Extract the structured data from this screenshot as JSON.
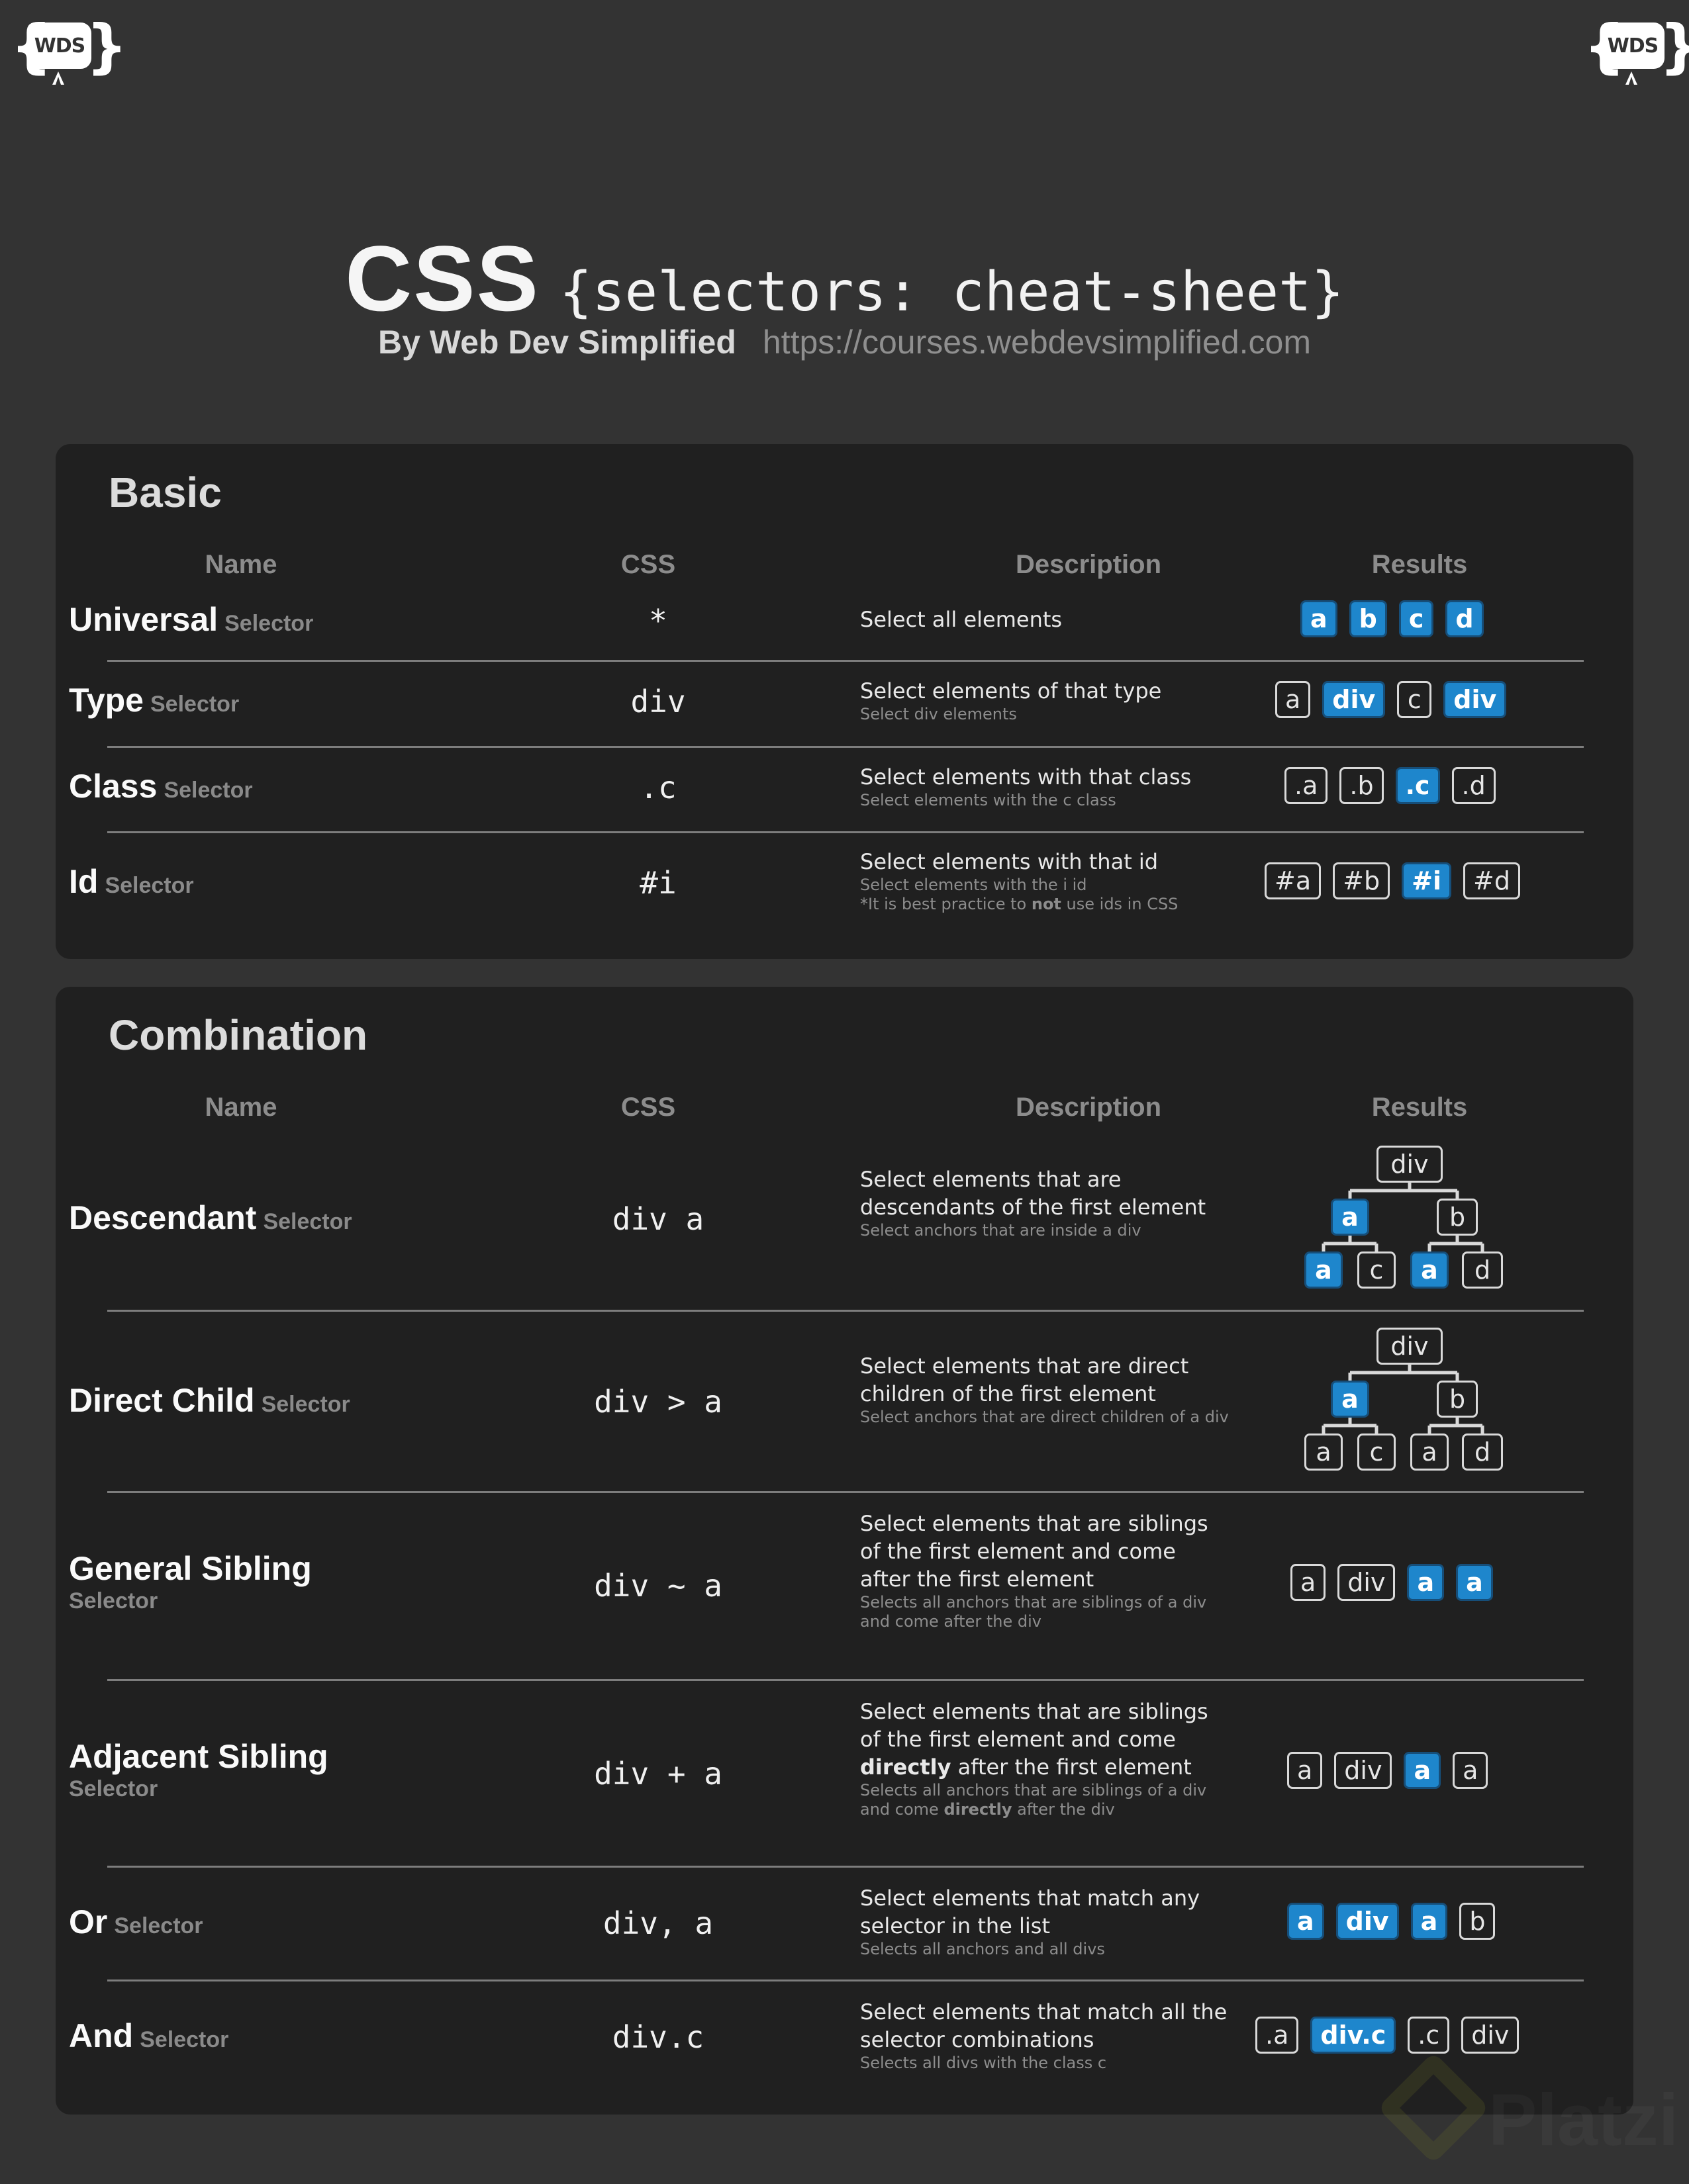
{
  "logo": {
    "text": "WDS",
    "left_brace": "{",
    "right_brace": "}"
  },
  "header": {
    "title_main": "CSS",
    "title_code": "{selectors: cheat-sheet}",
    "byline": "By Web Dev Simplified",
    "url": "https://courses.webdevsimplified.com"
  },
  "columns": {
    "name": "Name",
    "css": "CSS",
    "description": "Description",
    "results": "Results"
  },
  "colors": {
    "highlight": "#1e86cc",
    "card_bg": "#202020",
    "page_bg": "#333333"
  },
  "basic": {
    "title": "Basic",
    "rows": [
      {
        "name": "Universal",
        "suffix": "Selector",
        "css": "*",
        "desc": "Select all elements",
        "sub": "",
        "note": "",
        "results": [
          {
            "label": "a",
            "on": true
          },
          {
            "label": "b",
            "on": true
          },
          {
            "label": "c",
            "on": true
          },
          {
            "label": "d",
            "on": true
          }
        ]
      },
      {
        "name": "Type",
        "suffix": "Selector",
        "css": "div",
        "desc": "Select elements of that type",
        "sub": "Select div elements",
        "note": "",
        "results": [
          {
            "label": "a",
            "on": false
          },
          {
            "label": "div",
            "on": true
          },
          {
            "label": "c",
            "on": false
          },
          {
            "label": "div",
            "on": true
          }
        ]
      },
      {
        "name": "Class",
        "suffix": "Selector",
        "css": ".c",
        "desc": "Select elements with that class",
        "sub": "Select elements with the c class",
        "note": "",
        "results": [
          {
            "label": ".a",
            "on": false
          },
          {
            "label": ".b",
            "on": false
          },
          {
            "label": ".c",
            "on": true
          },
          {
            "label": ".d",
            "on": false
          }
        ]
      },
      {
        "name": "Id",
        "suffix": "Selector",
        "css": "#i",
        "desc": "Select elements with that id",
        "sub": "Select elements with the i id",
        "note_pre": "*It is best practice to ",
        "note_bold": "not",
        "note_post": " use ids in CSS",
        "results": [
          {
            "label": "#a",
            "on": false
          },
          {
            "label": "#b",
            "on": false
          },
          {
            "label": "#i",
            "on": true
          },
          {
            "label": "#d",
            "on": false
          }
        ]
      }
    ]
  },
  "combination": {
    "title": "Combination",
    "rows": [
      {
        "name": "Descendant",
        "suffix": "Selector",
        "css": "div a",
        "desc": "Select elements that are descendants of the first element",
        "sub": "Select anchors that are inside a div",
        "tree": {
          "root": "div",
          "left": {
            "label": "a",
            "on": true
          },
          "right": {
            "label": "b",
            "on": false
          },
          "leaves": [
            {
              "label": "a",
              "on": true
            },
            {
              "label": "c",
              "on": false
            },
            {
              "label": "a",
              "on": true
            },
            {
              "label": "d",
              "on": false
            }
          ]
        }
      },
      {
        "name": "Direct Child",
        "suffix": "Selector",
        "css": "div > a",
        "desc": "Select elements that are direct children of the first element",
        "sub": "Select anchors that are direct children of a div",
        "tree": {
          "root": "div",
          "left": {
            "label": "a",
            "on": true
          },
          "right": {
            "label": "b",
            "on": false
          },
          "leaves": [
            {
              "label": "a",
              "on": false
            },
            {
              "label": "c",
              "on": false
            },
            {
              "label": "a",
              "on": false
            },
            {
              "label": "d",
              "on": false
            }
          ]
        }
      },
      {
        "name": "General Sibling",
        "suffix": "Selector",
        "css": "div ~ a",
        "desc": "Select elements that are siblings of the first element and come after the first element",
        "sub": "Selects all anchors that are siblings of a div and come after the div",
        "results": [
          {
            "label": "a",
            "on": false
          },
          {
            "label": "div",
            "on": false
          },
          {
            "label": "a",
            "on": true
          },
          {
            "label": "a",
            "on": true
          }
        ]
      },
      {
        "name": "Adjacent Sibling",
        "suffix": "Selector",
        "css": "div + a",
        "desc_pre": "Select elements that are siblings of the first element and come ",
        "desc_bold": "directly",
        "desc_post": " after the first element",
        "sub_pre": "Selects all anchors that are siblings of a div and come ",
        "sub_bold": "directly",
        "sub_post": " after the div",
        "results": [
          {
            "label": "a",
            "on": false
          },
          {
            "label": "div",
            "on": false
          },
          {
            "label": "a",
            "on": true
          },
          {
            "label": "a",
            "on": false
          }
        ]
      },
      {
        "name": "Or",
        "suffix": "Selector",
        "css": "div, a",
        "desc": "Select elements that match any selector in the list",
        "sub": "Selects all anchors and all divs",
        "results": [
          {
            "label": "a",
            "on": true
          },
          {
            "label": "div",
            "on": true
          },
          {
            "label": "a",
            "on": true
          },
          {
            "label": "b",
            "on": false
          }
        ]
      },
      {
        "name": "And",
        "suffix": "Selector",
        "css": "div.c",
        "desc": "Select elements that match all the selector combinations",
        "sub": "Selects all divs with the class c",
        "results": [
          {
            "label": ".a",
            "on": false
          },
          {
            "label": "div.c",
            "on": true
          },
          {
            "label": ".c",
            "on": false
          },
          {
            "label": "div",
            "on": false
          }
        ]
      }
    ]
  },
  "watermark": {
    "text": "Platzi"
  }
}
